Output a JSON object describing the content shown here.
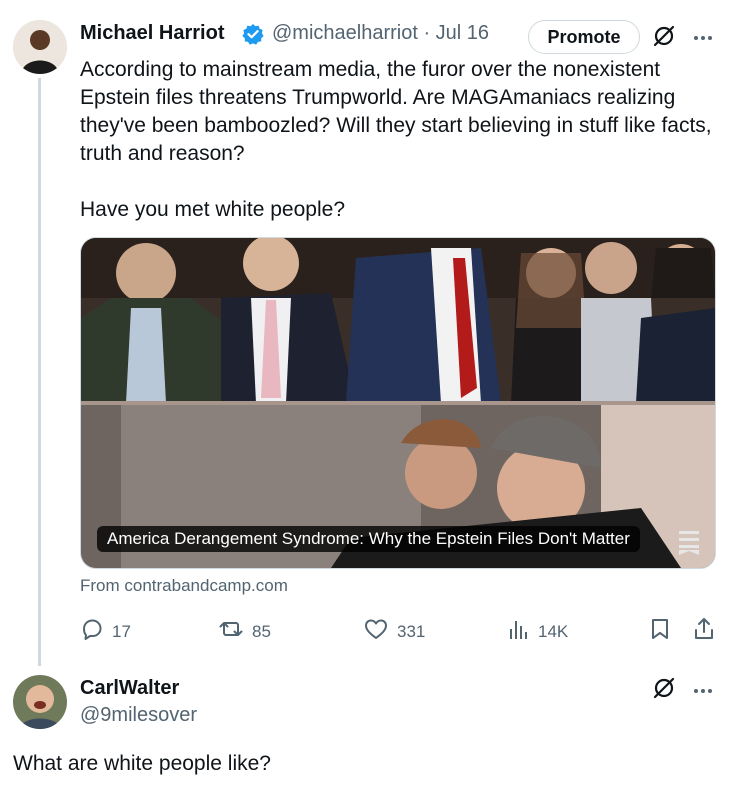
{
  "tweet": {
    "author_name": "Michael Harriot",
    "handle_date": "@michaelharriot · Jul 16",
    "promote_label": "Promote",
    "text": "According to mainstream media, the furor over the nonexistent Epstein files threatens Trumpworld. Are MAGAmaniacs realizing they've been bamboozled? Will they start believing in stuff like facts, truth and reason?\n\nHave you met white people?",
    "card": {
      "title": "America Derangement Syndrome: Why the Epstein Files Don't Matter",
      "source": "From contrabandcamp.com"
    },
    "actions": {
      "replies": "17",
      "reposts": "85",
      "likes": "331",
      "views": "14K"
    }
  },
  "reply": {
    "author_name": "CarlWalter",
    "handle": "@9milesover",
    "text": "What are white people like?"
  },
  "colors": {
    "verified": "#1d9bf0",
    "text_primary": "#0f1419",
    "text_secondary": "#536471"
  },
  "icons": [
    "verified-badge-icon",
    "grok-icon",
    "more-icon",
    "reply-icon",
    "repost-icon",
    "like-icon",
    "views-icon",
    "bookmark-icon",
    "share-icon",
    "article-icon"
  ]
}
